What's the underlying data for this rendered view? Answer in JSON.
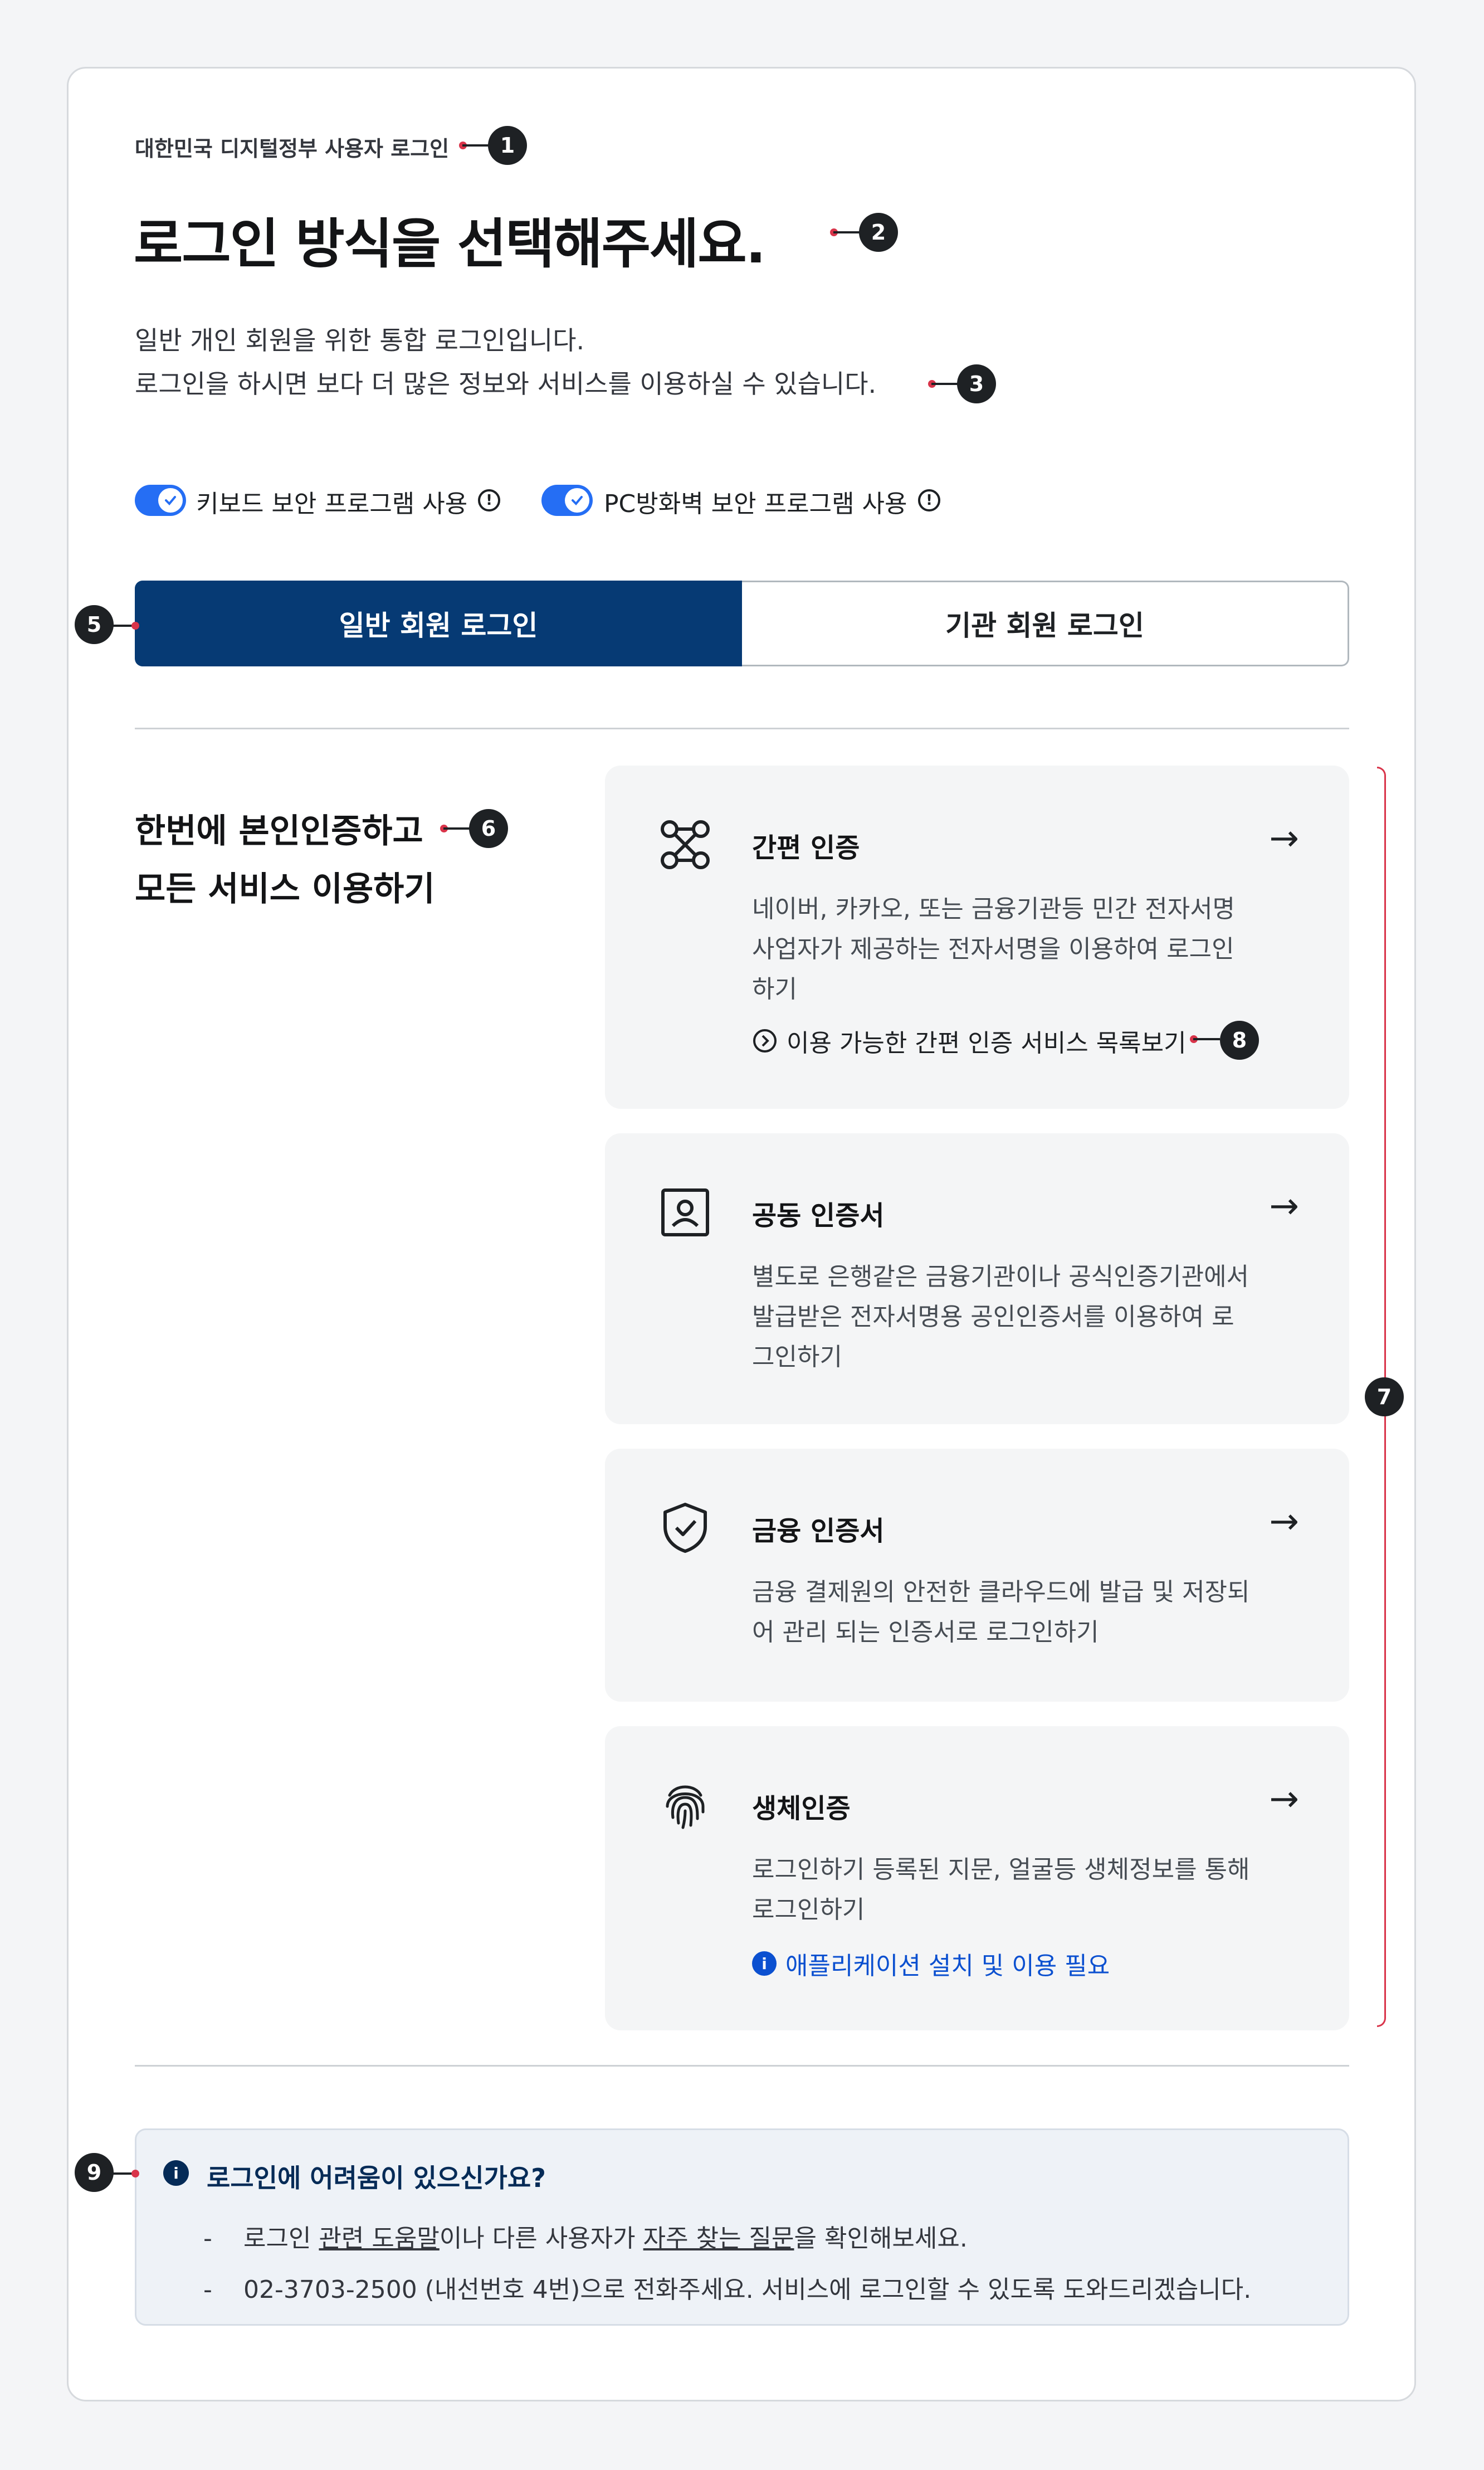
{
  "header": {
    "eyebrow": "대한민국 디지털정부 사용자 로그인",
    "title": "로그인 방식을 선택해주세요.",
    "desc_line1": "일반 개인 회원을 위한 통합 로그인입니다.",
    "desc_line2": "로그인을 하시면 보다 더 많은 정보와 서비스를 이용하실 수 있습니다."
  },
  "toggles": [
    {
      "label": "키보드 보안 프로그램 사용",
      "checked": true
    },
    {
      "label": "PC방화벽 보안 프로그램 사용",
      "checked": true
    }
  ],
  "tabs": [
    {
      "label": "일반 회원 로그인",
      "active": true
    },
    {
      "label": "기관 회원 로그인",
      "active": false
    }
  ],
  "section": {
    "headline_line1": "한번에 본인인증하고",
    "headline_line2": "모든 서비스 이용하기"
  },
  "methods": [
    {
      "icon": "simple-auth-icon",
      "title": "간편 인증",
      "desc": "네이버, 카카오, 또는 금융기관등 민간 전자서명 사업자가 제공하는 전자서명을 이용하여 로그인하기",
      "link": "이용 가능한 간편 인증 서비스 목록보기"
    },
    {
      "icon": "certificate-user-icon",
      "title": "공동 인증서",
      "desc": "별도로 은행같은 금융기관이나 공식인증기관에서 발급받은 전자서명용 공인인증서를 이용하여 로그인하기"
    },
    {
      "icon": "shield-check-icon",
      "title": "금융 인증서",
      "desc": "금융 결제원의 안전한 클라우드에 발급 및 저장되어 관리 되는 인증서로 로그인하기"
    },
    {
      "icon": "fingerprint-icon",
      "title": "생체인증",
      "desc": "로그인하기 등록된 지문, 얼굴등 생체정보를 통해 로그인하기",
      "note": "애플리케이션 설치 및 이용 필요"
    }
  ],
  "arrow": "→",
  "help": {
    "title": "로그인에 어려움이 있으신가요?",
    "dash": "-",
    "line1_a": "로그인 ",
    "line1_link1": "관련 도움말",
    "line1_b": "이나 다른 사용자가 ",
    "line1_link2": "자주 찾는 질문",
    "line1_c": "을 확인해보세요.",
    "line2": "02-3703-2500 (내선번호 4번)으로 전화주세요. 서비스에 로그인할 수 있도록 도와드리겠습니다."
  },
  "markers": [
    "1",
    "2",
    "3",
    "5",
    "6",
    "7",
    "8",
    "9"
  ],
  "colors": {
    "primary": "#063a74",
    "toggle": "#256ef4",
    "annotation": "#d9344a",
    "link": "#0b50d0"
  }
}
